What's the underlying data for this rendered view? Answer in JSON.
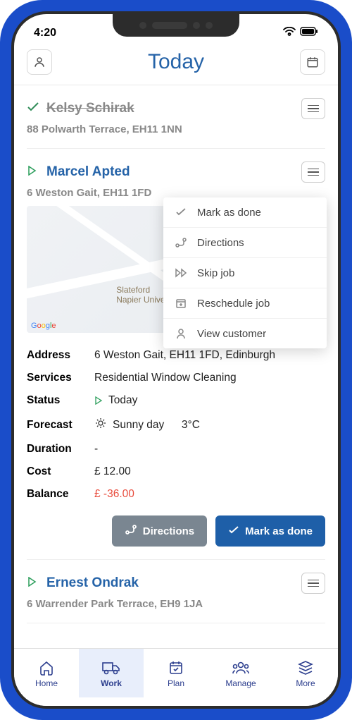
{
  "status_bar": {
    "time": "4:20"
  },
  "header": {
    "title": "Today"
  },
  "jobs": [
    {
      "name": "Kelsy Schirak",
      "address": "88 Polwarth Terrace, EH11 1NN"
    },
    {
      "name": "Marcel Apted",
      "address": "6 Weston Gait, EH11 1FD"
    },
    {
      "name": "Ernest Ondrak",
      "address": "6 Warrender Park Terrace, EH9 1JA"
    }
  ],
  "context_menu": {
    "mark_done": "Mark as done",
    "directions": "Directions",
    "skip": "Skip job",
    "reschedule": "Reschedule job",
    "view_customer": "View customer"
  },
  "map": {
    "poi_label": "Slateford\nNapier Universi",
    "attribution": "Google"
  },
  "details": {
    "address_label": "Address",
    "address_value": "6 Weston Gait, EH11 1FD, Edinburgh",
    "services_label": "Services",
    "services_value": "Residential Window Cleaning",
    "status_label": "Status",
    "status_value": "Today",
    "forecast_label": "Forecast",
    "forecast_value": "Sunny day",
    "forecast_temp": "3°C",
    "duration_label": "Duration",
    "duration_value": "-",
    "cost_label": "Cost",
    "cost_value": "£ 12.00",
    "balance_label": "Balance",
    "balance_value": "£ -36.00"
  },
  "actions": {
    "directions": "Directions",
    "mark_done": "Mark as done"
  },
  "nav": {
    "home": "Home",
    "work": "Work",
    "plan": "Plan",
    "manage": "Manage",
    "more": "More"
  }
}
